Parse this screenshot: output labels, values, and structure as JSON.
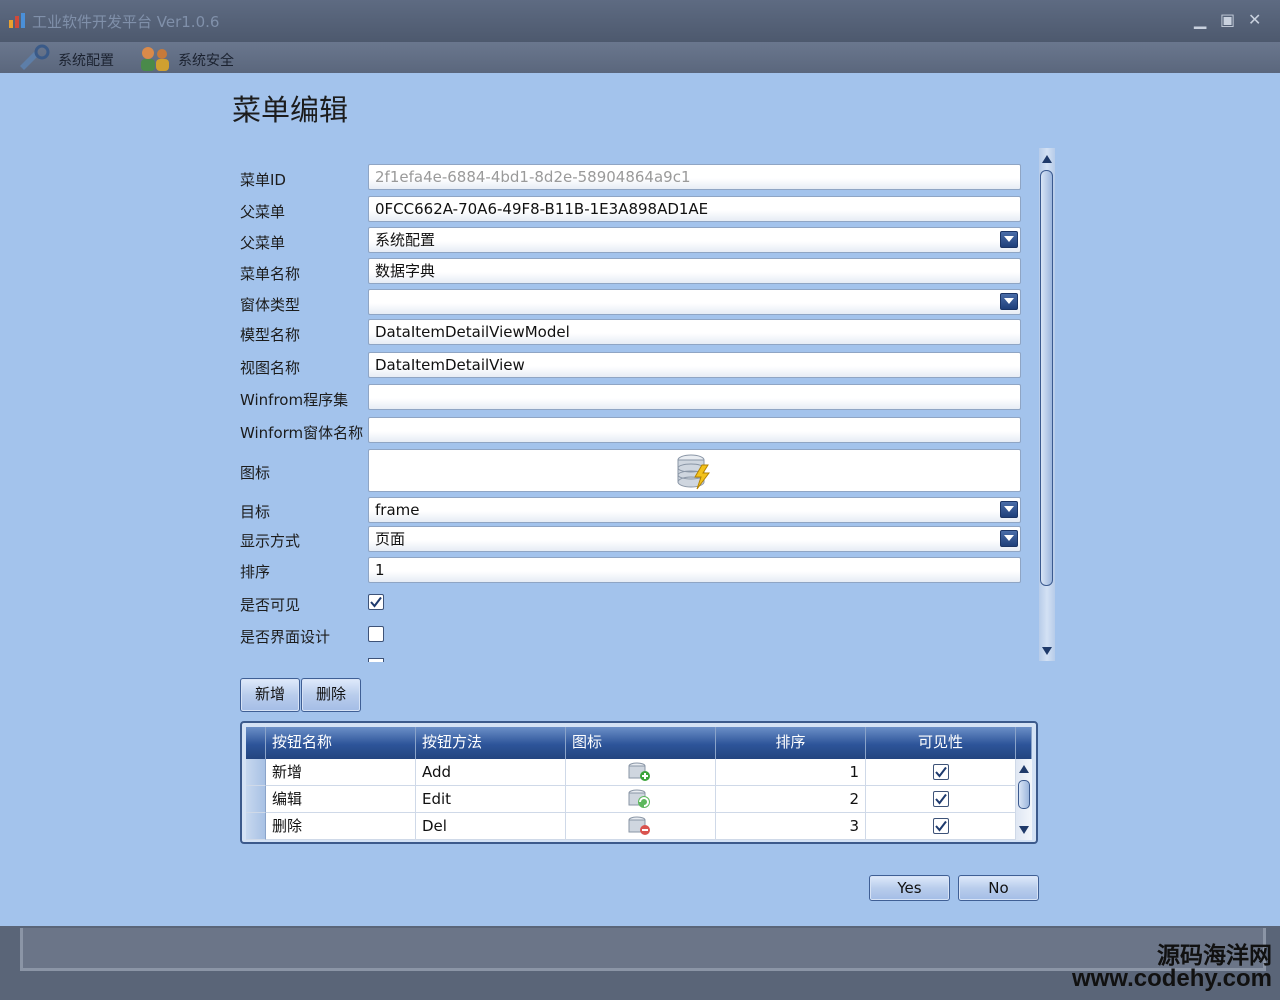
{
  "app": {
    "title": "工业软件开发平台 Ver1.0.6",
    "toolbar": [
      "系统配置",
      "系统安全"
    ]
  },
  "dialog": {
    "title": "菜单编辑",
    "fields": {
      "menu_id": {
        "label": "菜单ID",
        "value": "2f1efa4e-6884-4bd1-8d2e-58904864a9c1"
      },
      "parent_id": {
        "label": "父菜单",
        "value": "0FCC662A-70A6-49F8-B11B-1E3A898AD1AE"
      },
      "parent_menu": {
        "label": "父菜单",
        "value": "系统配置"
      },
      "menu_name": {
        "label": "菜单名称",
        "value": "数据字典"
      },
      "window_type": {
        "label": "窗体类型",
        "value": ""
      },
      "model_name": {
        "label": "模型名称",
        "value": "DataItemDetailViewModel"
      },
      "view_name": {
        "label": "视图名称",
        "value": "DataItemDetailView"
      },
      "winform_assembly": {
        "label": "Winfrom程序集",
        "value": ""
      },
      "winform_window": {
        "label": "Winform窗体名称",
        "value": ""
      },
      "icon": {
        "label": "图标"
      },
      "target": {
        "label": "目标",
        "value": "frame"
      },
      "display_mode": {
        "label": "显示方式",
        "value": "页面"
      },
      "sort": {
        "label": "排序",
        "value": "1"
      },
      "visible": {
        "label": "是否可见",
        "checked": true
      },
      "ui_design": {
        "label": "是否界面设计",
        "checked": false
      }
    },
    "buttons": {
      "add": "新增",
      "delete": "删除",
      "yes": "Yes",
      "no": "No"
    },
    "grid": {
      "columns": [
        "按钮名称",
        "按钮方法",
        "图标",
        "排序",
        "可见性"
      ],
      "rows": [
        {
          "name": "新增",
          "method": "Add",
          "icon": "db-add-icon",
          "sort": "1",
          "visible": true
        },
        {
          "name": "编辑",
          "method": "Edit",
          "icon": "db-refresh-icon",
          "sort": "2",
          "visible": true
        },
        {
          "name": "删除",
          "method": "Del",
          "icon": "db-delete-icon",
          "sort": "3",
          "visible": true
        }
      ]
    }
  },
  "watermark": {
    "line1": "源码海洋网",
    "line2": "www.codehy.com"
  }
}
